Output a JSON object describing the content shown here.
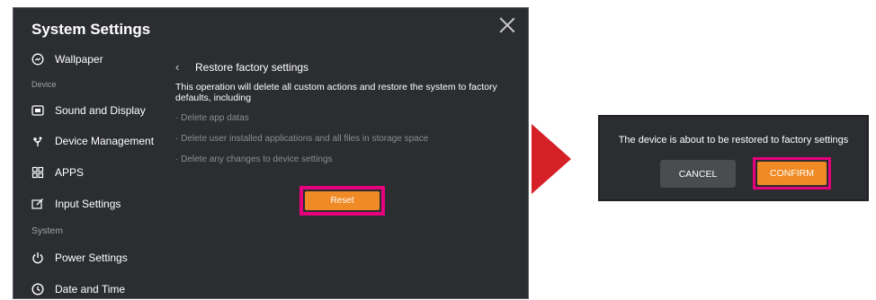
{
  "window": {
    "title": "System Settings",
    "sidebar": {
      "items_top": [
        {
          "label": "Wallpaper",
          "icon": "wallpaper-icon"
        }
      ],
      "section_device": "Device",
      "items_device": [
        {
          "label": "Sound and Display",
          "icon": "display-icon"
        },
        {
          "label": "Device Management",
          "icon": "device-management-icon"
        },
        {
          "label": "APPS",
          "icon": "apps-icon"
        },
        {
          "label": "Input Settings",
          "icon": "input-icon"
        }
      ],
      "section_system": "System",
      "items_system": [
        {
          "label": "Power Settings",
          "icon": "power-icon"
        },
        {
          "label": "Date and Time",
          "icon": "clock-icon"
        }
      ]
    },
    "main": {
      "back_label": "Restore factory settings",
      "description": "This operation will delete all custom actions and restore the system to factory defaults, including",
      "bullets": [
        "· Delete app datas",
        "· Delete user installed applications and all files in storage space",
        "· Delete any changes to device settings"
      ],
      "reset_label": "Reset"
    }
  },
  "dialog": {
    "message": "The device is about to be restored to factory settings",
    "cancel_label": "CANCEL",
    "confirm_label": "CONFIRM"
  },
  "colors": {
    "panel_bg": "#2b2d30",
    "accent_orange": "#f08a24",
    "highlight_magenta": "#e5007e",
    "arrow_red": "#d62027"
  }
}
